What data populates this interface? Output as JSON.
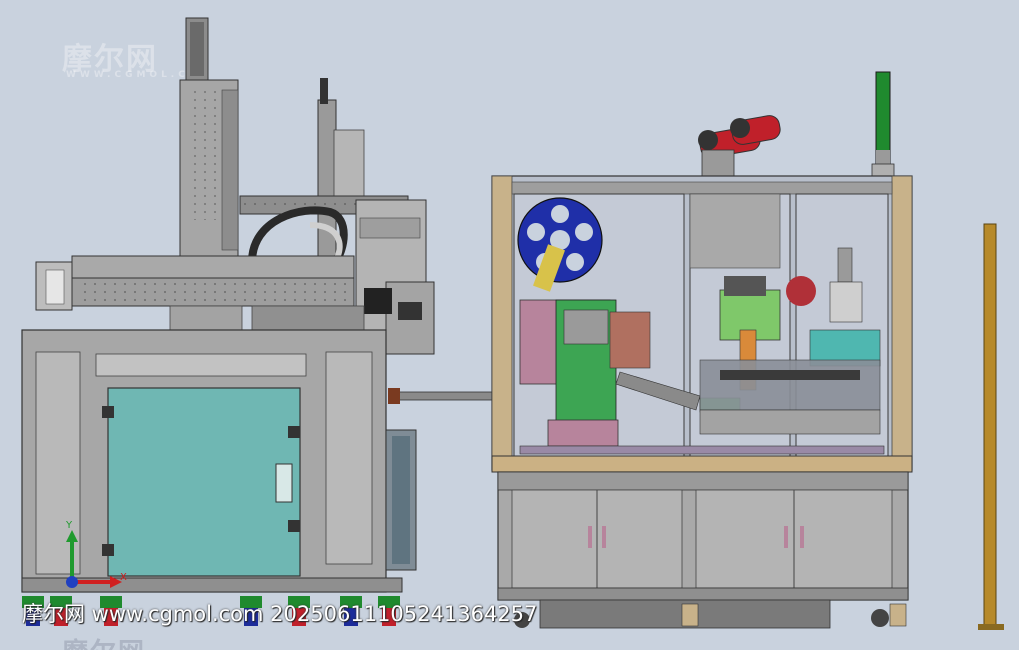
{
  "watermark": {
    "logo_cn": "摩尔网",
    "site": "WWW.CGMOL.COM"
  },
  "stamp": {
    "text": "摩尔网 www.cgmol.com 20250611105241364257"
  },
  "axes": {
    "x_label": "X",
    "y_label": "Y"
  },
  "colors": {
    "background": "#c9d2de",
    "frame_grey": "#9a9a9a",
    "door_teal": "#6fb7b3",
    "cabinet_grey": "#a9a9a9",
    "reel_blue": "#1f2fa8",
    "motor_red": "#c0202a",
    "signal_green": "#1f8a2e",
    "post_gold": "#b78a2a"
  }
}
